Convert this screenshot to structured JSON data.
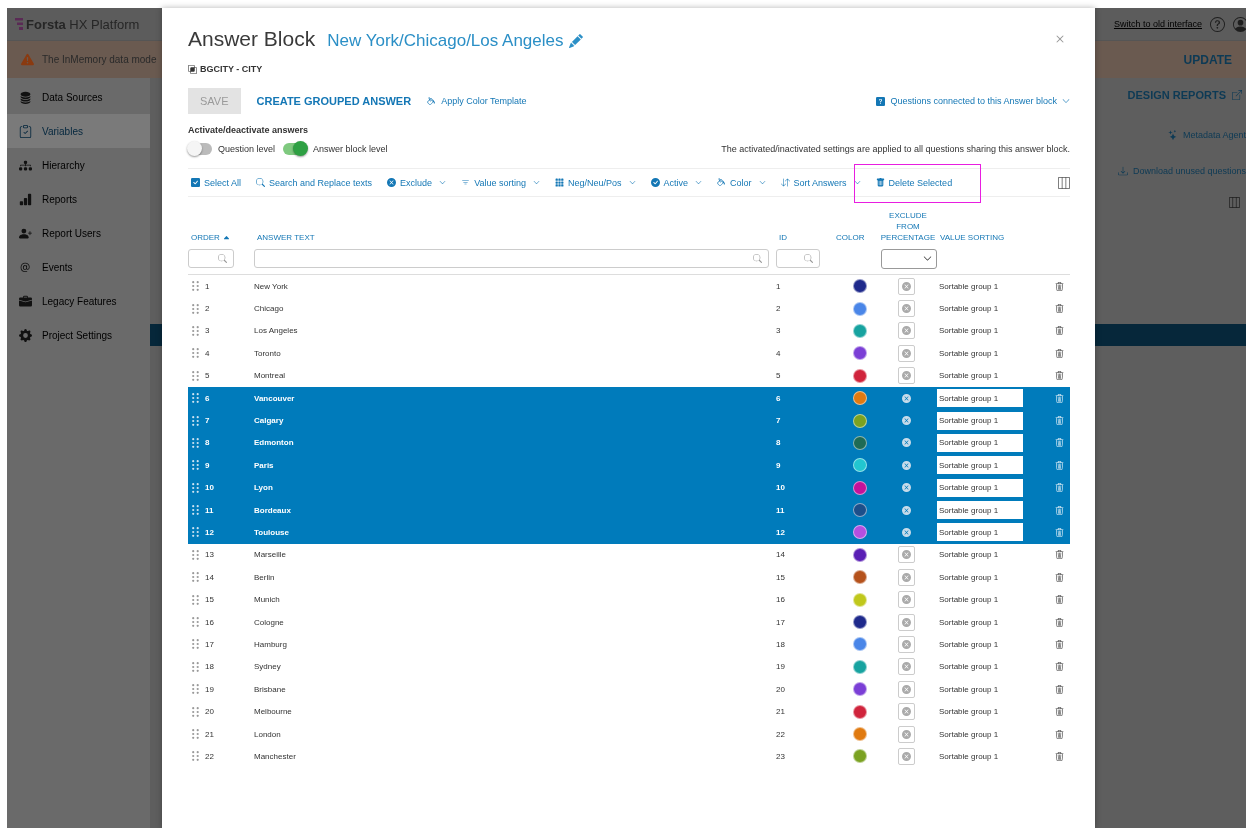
{
  "app": {
    "logo": "**Forsta** HX Platform",
    "top_link": "Switch to old interface",
    "banner": {
      "text": "The InMemory data mode",
      "action": "UPDATE"
    },
    "sidebar": {
      "items": [
        {
          "label": "Data Sources",
          "selected": false
        },
        {
          "label": "Variables",
          "selected": true
        },
        {
          "label": "Hierarchy",
          "selected": false
        },
        {
          "label": "Reports",
          "selected": false
        },
        {
          "label": "Report Users",
          "selected": false
        },
        {
          "label": "Events",
          "selected": false
        },
        {
          "label": "Legacy Features",
          "selected": false
        },
        {
          "label": "Project Settings",
          "selected": false
        }
      ]
    },
    "panel": {
      "tab_action": "DESIGN REPORTS",
      "actions": [
        "Metadata Agent",
        "Download unused questions"
      ]
    }
  },
  "dialog": {
    "title": "Answer Block",
    "subtitle": "New York/Chicago/Los Angeles",
    "variable": "BGCITY - CITY",
    "save": {
      "label": "SAVE",
      "disabled": true
    },
    "create": "CREATE GROUPED ANSWER",
    "template": "Apply Color Template",
    "connected": "Questions connected to this Answer block",
    "activation": {
      "heading": "Activate/deactivate answers",
      "toggles": [
        {
          "label": "Question level",
          "on": false
        },
        {
          "label": "Answer block level",
          "on": true
        }
      ],
      "note": "The activated/inactivated settings are applied to all questions sharing this answer block."
    },
    "toolbar": [
      {
        "label": "Select All",
        "dropdown": false,
        "highlighted": false
      },
      {
        "label": "Search and Replace texts",
        "dropdown": false,
        "highlighted": false
      },
      {
        "label": "Exclude",
        "dropdown": true,
        "highlighted": false
      },
      {
        "label": "Value sorting",
        "dropdown": true,
        "highlighted": false
      },
      {
        "label": "Neg/Neu/Pos",
        "dropdown": true,
        "highlighted": false
      },
      {
        "label": "Active",
        "dropdown": true,
        "highlighted": false
      },
      {
        "label": "Color",
        "dropdown": true,
        "highlighted": false
      },
      {
        "label": "Sort Answers",
        "dropdown": true,
        "highlighted": false
      },
      {
        "label": "Delete Selected",
        "dropdown": false,
        "highlighted": true
      }
    ],
    "table": {
      "columns": [
        {
          "label": "ORDER",
          "sorted": true
        },
        {
          "label": "ANSWER TEXT",
          "sorted": false
        },
        {
          "label": "ID",
          "sorted": false
        },
        {
          "label": "COLOR",
          "sorted": false
        },
        {
          "label": "EXCLUDE FROM PERCENTAGE",
          "sorted": false
        },
        {
          "label": "VALUE SORTING",
          "sorted": false
        }
      ],
      "rows": [
        {
          "order": "1",
          "text": "New York",
          "id": "1",
          "color": "#1f2a8c",
          "value_sorting": "Sortable group 1",
          "selected": false
        },
        {
          "order": "2",
          "text": "Chicago",
          "id": "2",
          "color": "#4a86e8",
          "value_sorting": "Sortable group 1",
          "selected": false
        },
        {
          "order": "3",
          "text": "Los Angeles",
          "id": "3",
          "color": "#17a3a0",
          "value_sorting": "Sortable group 1",
          "selected": false
        },
        {
          "order": "4",
          "text": "Toronto",
          "id": "4",
          "color": "#7b3fd6",
          "value_sorting": "Sortable group 1",
          "selected": false
        },
        {
          "order": "5",
          "text": "Montreal",
          "id": "5",
          "color": "#d0243c",
          "value_sorting": "Sortable group 1",
          "selected": false
        },
        {
          "order": "6",
          "text": "Vancouver",
          "id": "6",
          "color": "#e07a10",
          "value_sorting": "Sortable group 1",
          "selected": true
        },
        {
          "order": "7",
          "text": "Calgary",
          "id": "7",
          "color": "#7ba222",
          "value_sorting": "Sortable group 1",
          "selected": true
        },
        {
          "order": "8",
          "text": "Edmonton",
          "id": "8",
          "color": "#1e6b55",
          "value_sorting": "Sortable group 1",
          "selected": true
        },
        {
          "order": "9",
          "text": "Paris",
          "id": "9",
          "color": "#22c6d0",
          "value_sorting": "Sortable group 1",
          "selected": true
        },
        {
          "order": "10",
          "text": "Lyon",
          "id": "10",
          "color": "#c4129a",
          "value_sorting": "Sortable group 1",
          "selected": true
        },
        {
          "order": "11",
          "text": "Bordeaux",
          "id": "11",
          "color": "#1c4f8a",
          "value_sorting": "Sortable group 1",
          "selected": true
        },
        {
          "order": "12",
          "text": "Toulouse",
          "id": "12",
          "color": "#b44fe0",
          "value_sorting": "Sortable group 1",
          "selected": true
        },
        {
          "order": "13",
          "text": "Marseille",
          "id": "14",
          "color": "#5a1fb5",
          "value_sorting": "Sortable group 1",
          "selected": false
        },
        {
          "order": "14",
          "text": "Berlin",
          "id": "15",
          "color": "#b5521c",
          "value_sorting": "Sortable group 1",
          "selected": false
        },
        {
          "order": "15",
          "text": "Munich",
          "id": "16",
          "color": "#c0c81c",
          "value_sorting": "Sortable group 1",
          "selected": false
        },
        {
          "order": "16",
          "text": "Cologne",
          "id": "17",
          "color": "#1f2a8c",
          "value_sorting": "Sortable group 1",
          "selected": false
        },
        {
          "order": "17",
          "text": "Hamburg",
          "id": "18",
          "color": "#4a86e8",
          "value_sorting": "Sortable group 1",
          "selected": false
        },
        {
          "order": "18",
          "text": "Sydney",
          "id": "19",
          "color": "#17a3a0",
          "value_sorting": "Sortable group 1",
          "selected": false
        },
        {
          "order": "19",
          "text": "Brisbane",
          "id": "20",
          "color": "#7b3fd6",
          "value_sorting": "Sortable group 1",
          "selected": false
        },
        {
          "order": "20",
          "text": "Melbourne",
          "id": "21",
          "color": "#d0243c",
          "value_sorting": "Sortable group 1",
          "selected": false
        },
        {
          "order": "21",
          "text": "London",
          "id": "22",
          "color": "#e07a10",
          "value_sorting": "Sortable group 1",
          "selected": false
        },
        {
          "order": "22",
          "text": "Manchester",
          "id": "23",
          "color": "#7ba222",
          "value_sorting": "Sortable group 1",
          "selected": false
        }
      ]
    }
  }
}
